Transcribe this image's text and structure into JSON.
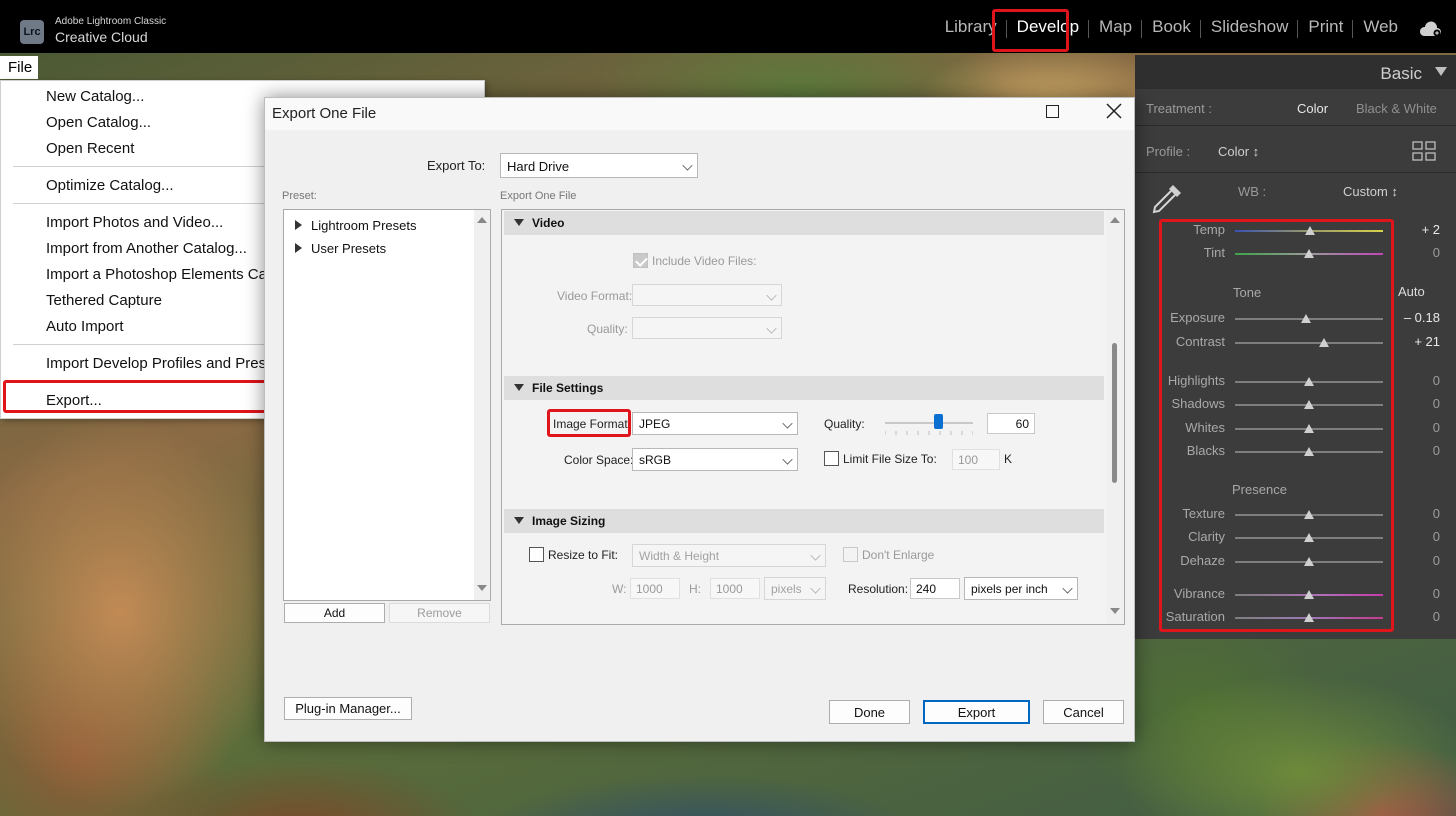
{
  "app": {
    "logo_text": "Lrc",
    "brand_line1": "Adobe Lightroom Classic",
    "brand_line2": "Creative Cloud"
  },
  "modules": [
    "Library",
    "Develop",
    "Map",
    "Book",
    "Slideshow",
    "Print",
    "Web"
  ],
  "active_module": "Develop",
  "right_panel": {
    "title": "Basic",
    "treatment_label": "Treatment :",
    "treatment_color": "Color",
    "treatment_bw": "Black & White",
    "profile_label": "Profile :",
    "profile_value": "Color ↕",
    "wb_label": "WB :",
    "wb_value": "Custom ↕",
    "tone_title": "Tone",
    "auto_label": "Auto",
    "presence_title": "Presence",
    "sliders": [
      {
        "label": "Temp",
        "value": "+ 2",
        "pos": 0.51
      },
      {
        "label": "Tint",
        "value": "0",
        "pos": 0.5
      },
      {
        "label": "Exposure",
        "value": "– 0.18",
        "pos": 0.48
      },
      {
        "label": "Contrast",
        "value": "+ 21",
        "pos": 0.6
      },
      {
        "label": "Highlights",
        "value": "0",
        "pos": 0.5
      },
      {
        "label": "Shadows",
        "value": "0",
        "pos": 0.5
      },
      {
        "label": "Whites",
        "value": "0",
        "pos": 0.5
      },
      {
        "label": "Blacks",
        "value": "0",
        "pos": 0.5
      },
      {
        "label": "Texture",
        "value": "0",
        "pos": 0.5
      },
      {
        "label": "Clarity",
        "value": "0",
        "pos": 0.5
      },
      {
        "label": "Dehaze",
        "value": "0",
        "pos": 0.5
      },
      {
        "label": "Vibrance",
        "value": "0",
        "pos": 0.5
      },
      {
        "label": "Saturation",
        "value": "0",
        "pos": 0.5
      }
    ]
  },
  "file_menu": {
    "label": "File",
    "items": [
      "New Catalog...",
      "Open Catalog...",
      "Open Recent",
      "Optimize Catalog...",
      "Import Photos and Video...",
      "Import from Another Catalog...",
      "Import a Photoshop Elements Cat",
      "Tethered Capture",
      "Auto Import",
      "Import Develop Profiles and Pres",
      "Export..."
    ]
  },
  "dialog": {
    "title": "Export One File",
    "export_to_label": "Export To:",
    "export_to_value": "Hard Drive",
    "preset_label": "Preset:",
    "settings_label": "Export One File",
    "presets": [
      "Lightroom Presets",
      "User Presets"
    ],
    "add_label": "Add",
    "remove_label": "Remove",
    "video": {
      "title": "Video",
      "include_label": "Include Video Files:",
      "format_label": "Video Format:",
      "quality_label": "Quality:"
    },
    "file_settings": {
      "title": "File Settings",
      "image_format_label": "Image Format:",
      "image_format_value": "JPEG",
      "quality_label": "Quality:",
      "quality_value": "60",
      "quality_level": 0.6,
      "color_space_label": "Color Space:",
      "color_space_value": "sRGB",
      "limit_label": "Limit File Size To:",
      "limit_value": "100",
      "limit_unit": "K"
    },
    "image_sizing": {
      "title": "Image Sizing",
      "resize_label": "Resize to Fit:",
      "resize_value": "Width & Height",
      "dont_enlarge_label": "Don't Enlarge",
      "w_label": "W:",
      "w_value": "1000",
      "h_label": "H:",
      "h_value": "1000",
      "units_value": "pixels",
      "resolution_label": "Resolution:",
      "resolution_value": "240",
      "resolution_units": "pixels per inch"
    },
    "plugin_manager_label": "Plug-in Manager...",
    "done_label": "Done",
    "export_label": "Export",
    "cancel_label": "Cancel"
  },
  "colors": {
    "highlight": "#e0141b",
    "accent": "#0067c0"
  }
}
